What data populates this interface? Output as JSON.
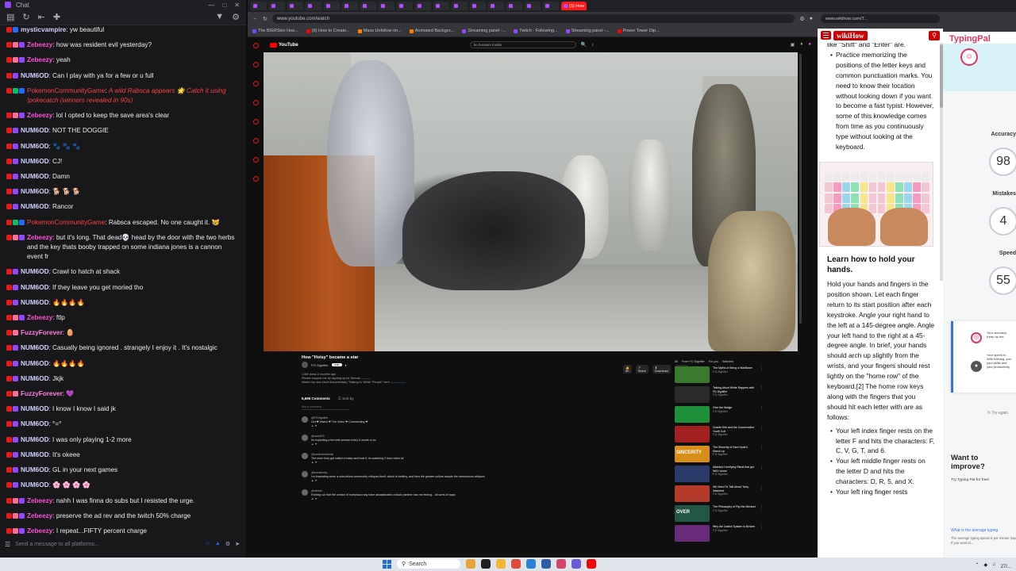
{
  "chat": {
    "window_title": "Chat",
    "input_placeholder": "Send a message to all platforms...",
    "messages": [
      {
        "user": "mysticvampire",
        "user_class": "u-num",
        "badges": [
          "b-red",
          "b-blue"
        ],
        "text": "yw beautiful"
      },
      {
        "user": "Zebeezy",
        "user_class": "u-zeb",
        "badges": [
          "b-red",
          "b-pink",
          "b-purple"
        ],
        "text": "how was resident evil yesterday?"
      },
      {
        "user": "Zebeezy",
        "user_class": "u-zeb",
        "badges": [
          "b-red",
          "b-pink",
          "b-purple"
        ],
        "text": "yeah"
      },
      {
        "user": "NUM6OD",
        "user_class": "u-num",
        "badges": [
          "b-red",
          "b-purple"
        ],
        "text": "Can I play with ya for a few or u full"
      },
      {
        "user": "PokemonCommunityGame",
        "user_class": "u-poke",
        "badges": [
          "b-red",
          "b-green",
          "b-blue"
        ],
        "text": "A wild Rabsca appears 🌟 Catch it using !pokecatch (winners revealed in 90s)",
        "italic": true
      },
      {
        "user": "Zebeezy",
        "user_class": "u-zeb",
        "badges": [
          "b-red",
          "b-pink",
          "b-purple"
        ],
        "text": "lol I opted to keep the save area's clear"
      },
      {
        "user": "NUM6OD",
        "user_class": "u-num",
        "badges": [
          "b-red",
          "b-purple"
        ],
        "text": "NOT THE DOGGIE"
      },
      {
        "user": "NUM6OD",
        "user_class": "u-num",
        "badges": [
          "b-red",
          "b-purple"
        ],
        "text": "🐾 🐾 🐾"
      },
      {
        "user": "NUM6OD",
        "user_class": "u-num",
        "badges": [
          "b-red",
          "b-purple"
        ],
        "text": "CJ!"
      },
      {
        "user": "NUM6OD",
        "user_class": "u-num",
        "badges": [
          "b-red",
          "b-purple"
        ],
        "text": "Damn"
      },
      {
        "user": "NUM6OD",
        "user_class": "u-num",
        "badges": [
          "b-red",
          "b-purple"
        ],
        "text": "🐕 🐕 🐕"
      },
      {
        "user": "NUM6OD",
        "user_class": "u-num",
        "badges": [
          "b-red",
          "b-purple"
        ],
        "text": "Rancor"
      },
      {
        "user": "PokemonCommunityGame",
        "user_class": "u-poke",
        "badges": [
          "b-red",
          "b-green",
          "b-blue"
        ],
        "text": "Rabsca escaped. No one caught it. 😿"
      },
      {
        "user": "Zebeezy",
        "user_class": "u-zeb",
        "badges": [
          "b-red",
          "b-pink",
          "b-purple"
        ],
        "text": "but it's long. That dead💀 head by the door with the two herbs and the key thats booby trapped on some indiana jones is a cannon event fr"
      },
      {
        "user": "NUM6OD",
        "user_class": "u-num",
        "badges": [
          "b-red",
          "b-purple"
        ],
        "text": "Crawl to hatch at shack"
      },
      {
        "user": "NUM6OD",
        "user_class": "u-num",
        "badges": [
          "b-red",
          "b-purple"
        ],
        "text": "If they leave you get moried tho"
      },
      {
        "user": "NUM6OD",
        "user_class": "u-num",
        "badges": [
          "b-red",
          "b-purple"
        ],
        "text": "🔥🔥🔥🔥"
      },
      {
        "user": "Zebeezy",
        "user_class": "u-zeb",
        "badges": [
          "b-red",
          "b-pink",
          "b-purple"
        ],
        "text": "ftlp"
      },
      {
        "user": "FuzzyForever",
        "user_class": "u-fuzzy",
        "badges": [
          "b-red",
          "b-pink"
        ],
        "text": "🥚"
      },
      {
        "user": "NUM6OD",
        "user_class": "u-num",
        "badges": [
          "b-red",
          "b-purple"
        ],
        "text": "Casually being ignored . strangely I enjoy it . It's nostalgic"
      },
      {
        "user": "NUM6OD",
        "user_class": "u-num",
        "badges": [
          "b-red",
          "b-purple"
        ],
        "text": "🔥🔥🔥🔥"
      },
      {
        "user": "NUM6OD",
        "user_class": "u-num",
        "badges": [
          "b-red",
          "b-purple"
        ],
        "text": "Jkjk"
      },
      {
        "user": "FuzzyForever",
        "user_class": "u-fuzzy",
        "badges": [
          "b-red",
          "b-pink"
        ],
        "text": "💜"
      },
      {
        "user": "NUM6OD",
        "user_class": "u-num",
        "badges": [
          "b-red",
          "b-purple"
        ],
        "text": "I know I know I said jk"
      },
      {
        "user": "NUM6OD",
        "user_class": "u-num",
        "badges": [
          "b-red",
          "b-purple"
        ],
        "text": "°=°"
      },
      {
        "user": "NUM6OD",
        "user_class": "u-num",
        "badges": [
          "b-red",
          "b-purple"
        ],
        "text": "I was only playing 1-2 more"
      },
      {
        "user": "NUM6OD",
        "user_class": "u-num",
        "badges": [
          "b-red",
          "b-purple"
        ],
        "text": "It's okeee"
      },
      {
        "user": "NUM6OD",
        "user_class": "u-num",
        "badges": [
          "b-red",
          "b-purple"
        ],
        "text": "GL in your next games"
      },
      {
        "user": "NUM6OD",
        "user_class": "u-num",
        "badges": [
          "b-red",
          "b-purple"
        ],
        "text": "🌸 🌸 🌸 🌸"
      },
      {
        "user": "Zebeezy",
        "user_class": "u-zeb",
        "badges": [
          "b-red",
          "b-pink",
          "b-purple"
        ],
        "text": "nahh I was finna do subs but I resisted the urge."
      },
      {
        "user": "Zebeezy",
        "user_class": "u-zeb",
        "badges": [
          "b-red",
          "b-pink",
          "b-purple"
        ],
        "text": "preserve the ad rev and the twitch 50% charge"
      },
      {
        "user": "Zebeezy",
        "user_class": "u-zeb",
        "badges": [
          "b-red",
          "b-pink",
          "b-purple"
        ],
        "text": "I repeat...FIFTY percent charge"
      }
    ]
  },
  "browser": {
    "url": "www.youtube.com/watch",
    "tabs": [
      "",
      "",
      "",
      "",
      "",
      "",
      "",
      "",
      "",
      "",
      "",
      "",
      "",
      "",
      "",
      "",
      "",
      "(5) How"
    ],
    "bookmarks": [
      {
        "label": "The B/ERSkin Hoo...",
        "color": "#6a4cff"
      },
      {
        "label": "(6) How to Create...",
        "color": "#ff0000"
      },
      {
        "label": "Mass Unfollow on...",
        "color": "#ff7a00"
      },
      {
        "label": "Animated Backgro...",
        "color": "#ff7a00"
      },
      {
        "label": "Streaming panel -...",
        "color": "#9147ff"
      },
      {
        "label": "Twitch - Following...",
        "color": "#9147ff"
      },
      {
        "label": "Streaming panel -...",
        "color": "#9147ff"
      },
      {
        "label": "Power Tower Dip...",
        "color": "#ff0000"
      }
    ],
    "yt_logo": "YouTube",
    "search_value": "bo bookem inside",
    "video_title": "How \"Hoisy\" became a star",
    "channel_name": "F.D Signifier",
    "subscribe_label": "Join",
    "action_labels": [
      "👍 8K",
      "↗ Share",
      "⬇ Download",
      "✂ Thanks"
    ],
    "description_1": "1.5M views  3 months ago",
    "description_2": "Please support me by signing up for Nebula",
    "description_3": "Watch my new short documentary \"Talking to 'White' People\" here",
    "comments_count": "5,696 Comments",
    "sort_label": "Sort by",
    "add_comment": "Add a comment...",
    "comments": [
      {
        "handle": "@FDSignifier",
        "text": "Get ❤ Watch ❤ The Video ❤ Commenting ❤"
      },
      {
        "handle": "@user823",
        "text": "Im expecting a terrorist scream every 5 words or so"
      },
      {
        "handle": "@commentsforall",
        "text": "The more they got called a hotep and took it, im watching 2 hour video lol"
      },
      {
        "handle": "@somebody",
        "text": "I'm frustrating when a subcultural community critiques itself, which is healthy, and then the greater culture adopts the harmonious critiques"
      },
      {
        "handle": "@viewer",
        "text": "Finding out that the creator of hoteplaza may have assassinated a black panther has me feeling... all sorts of ways"
      }
    ],
    "rec_chips": [
      "All",
      "From F.D Signifier",
      "For you",
      "Watched"
    ],
    "recs": [
      {
        "title": "The Myths of Being a Wallflower",
        "channel": "F.D Signifier",
        "color": "#3a7a2c"
      },
      {
        "title": "Talking About White Rappers with FD Signifier",
        "channel": "F.D Signifier",
        "color": "#2a2a2a"
      },
      {
        "title": "Give the Nudge",
        "channel": "F.D Signifier",
        "color": "#1f8f3a"
      },
      {
        "title": "Charlie Kirk and the Conservative Youth Cult",
        "channel": "F.D Signifier",
        "color": "#a32020"
      },
      {
        "title": "The Sincerity of Sam Hyde's Stand-Up",
        "channel": "F.D Signifier",
        "color": "#d98d1a"
      },
      {
        "title": "Atlanta's Horrifying Ritual that got WAY worse",
        "channel": "F.D Signifier",
        "color": "#2a3a6a"
      },
      {
        "title": "We Need To Talk About Tariq Nasheed",
        "channel": "F.D Signifier",
        "color": "#b43a2a"
      },
      {
        "title": "The Philosophy of Flip the Mindset",
        "channel": "F.D Signifier",
        "color": "#225544"
      },
      {
        "title": "Why the Justice System Is Broken",
        "channel": "F.D Signifier",
        "color": "#6a2a7a"
      }
    ],
    "rec_badges": {
      "rec_4": "SINCERITY",
      "rec_7": "OVER"
    }
  },
  "article": {
    "url": "www.wikihow.com/T...",
    "logo": "wikiHow",
    "intro_cut": "like \"Shift\" and \"Enter\" are.",
    "para_1": "Practice memorizing the positions of the letter keys and common punctuation marks. You need to know their location without looking down if you want to become a fast typist. However, some of this knowledge comes from time as you continuously type without looking at the keyboard.",
    "heading": "Learn how to hold your hands.",
    "para_2": "Hold your hands and fingers in the position shown. Let each finger return to its start position after each keystroke. Angle your right hand to the left at a 145-degree angle. Angle your left hand to the right at a 45-degree angle. In brief, your hands should arch up slightly from the wrists, and your fingers should rest lightly on the \"home row\" of the keyboard.[2] The home row keys along with the fingers that you should hit each letter with are as follows:",
    "bullet_1": "Your left index finger rests on the letter F and hits the characters: F, C, V, G, T, and 6.",
    "bullet_2": "Your left middle finger rests on the letter D and hits the characters: D, R, 5, and X.",
    "bullet_3": "Your left ring finger rests"
  },
  "typingpal": {
    "logo": "TypingPal",
    "accuracy_label": "Accuracy",
    "accuracy_value": "98",
    "mistakes_label": "Mistakes",
    "mistakes_value": "4",
    "speed_label": "Speed",
    "speed_value": "55",
    "card_line_1": "Your accuracy",
    "card_line_1b": "Keep up the",
    "card_line_2": "Your speed is",
    "card_line_2b": "With training, you",
    "card_line_2c": "your skills and",
    "card_line_2d": "your productivity",
    "try_again": "Try again",
    "improve_1": "Want to",
    "improve_2": "improve?",
    "improve_sub": "Try Typing Pal for free!",
    "link": "What is the average typing",
    "small": "The average typing speed is per minute (wpm). If you want to..."
  },
  "taskbar": {
    "search_label": "Search",
    "time": "",
    "date": "27/..."
  }
}
